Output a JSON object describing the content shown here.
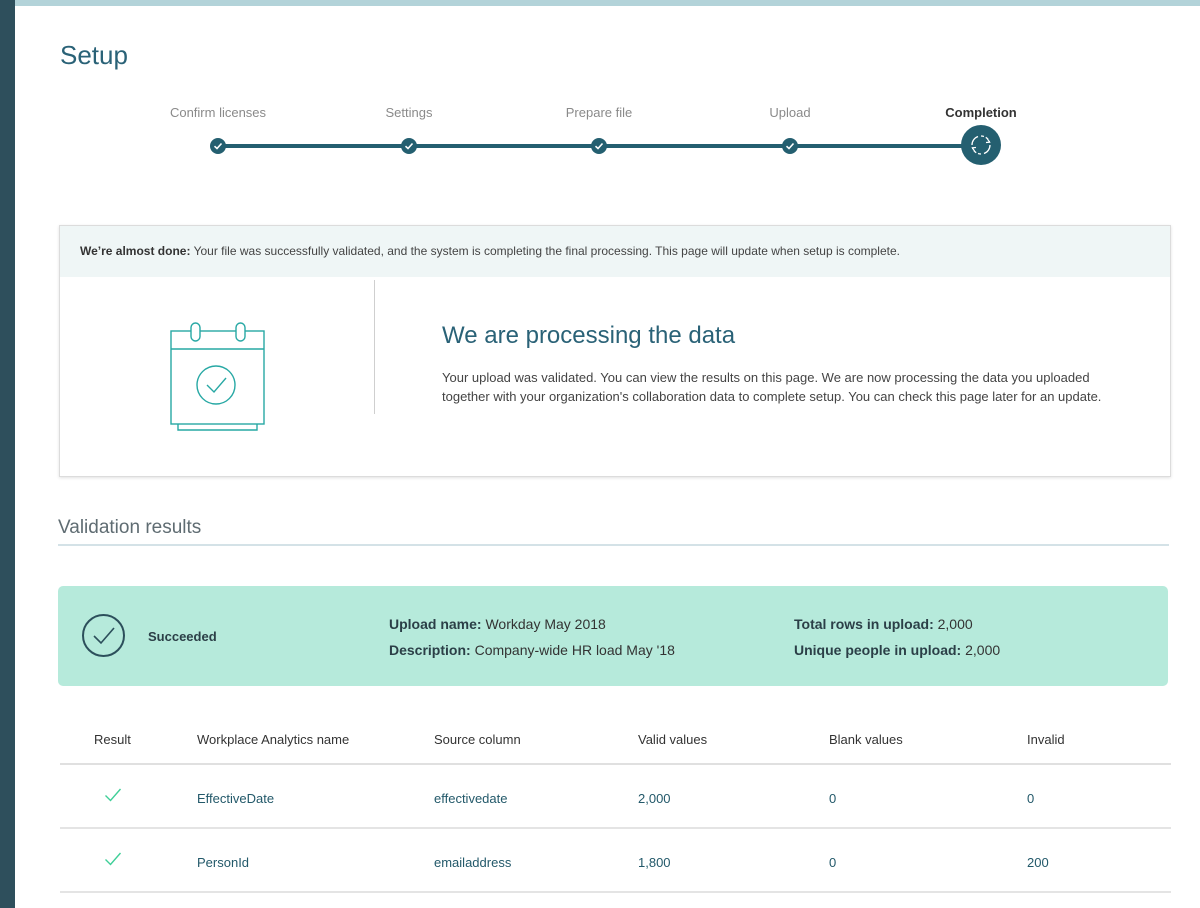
{
  "page": {
    "title": "Setup"
  },
  "colors": {
    "accent": "#245f70",
    "success_bg": "#b6eadb",
    "check_green": "#3fcf98"
  },
  "stepper": {
    "steps": [
      {
        "label": "Confirm licenses",
        "state": "done",
        "icon": "check-icon"
      },
      {
        "label": "Settings",
        "state": "done",
        "icon": "check-icon"
      },
      {
        "label": "Prepare file",
        "state": "done",
        "icon": "check-icon"
      },
      {
        "label": "Upload",
        "state": "done",
        "icon": "check-icon"
      },
      {
        "label": "Completion",
        "state": "current",
        "icon": "spinner-icon"
      }
    ]
  },
  "banner": {
    "lead": "We’re almost done:",
    "text": "Your file was successfully validated, and the system is completing the final processing. This page will update when setup is complete."
  },
  "processing": {
    "illustration_icon": "calendar-check-icon",
    "heading": "We are processing the data",
    "body": "Your upload was validated. You can view the results on this page. We are now processing the data you uploaded together with your organization's collaboration data to complete setup. You can check this page later for an update."
  },
  "validation": {
    "title": "Validation results",
    "status": "Succeeded",
    "status_icon": "check-circle-icon",
    "upload_name_label": "Upload name:",
    "upload_name": "Workday May 2018",
    "description_label": "Description:",
    "description": "Company-wide HR load May '18",
    "total_rows_label": "Total rows in upload:",
    "total_rows": "2,000",
    "unique_people_label": "Unique people in upload:",
    "unique_people": "2,000"
  },
  "table": {
    "headers": [
      "Result",
      "Workplace Analytics name",
      "Source column",
      "Valid values",
      "Blank values",
      "Invalid"
    ],
    "rows": [
      {
        "result_icon": "check-icon",
        "name": "EffectiveDate",
        "source": "effectivedate",
        "valid": "2,000",
        "blank": "0",
        "invalid": "0"
      },
      {
        "result_icon": "check-icon",
        "name": "PersonId",
        "source": "emailaddress",
        "valid": "1,800",
        "blank": "0",
        "invalid": "200"
      }
    ]
  }
}
